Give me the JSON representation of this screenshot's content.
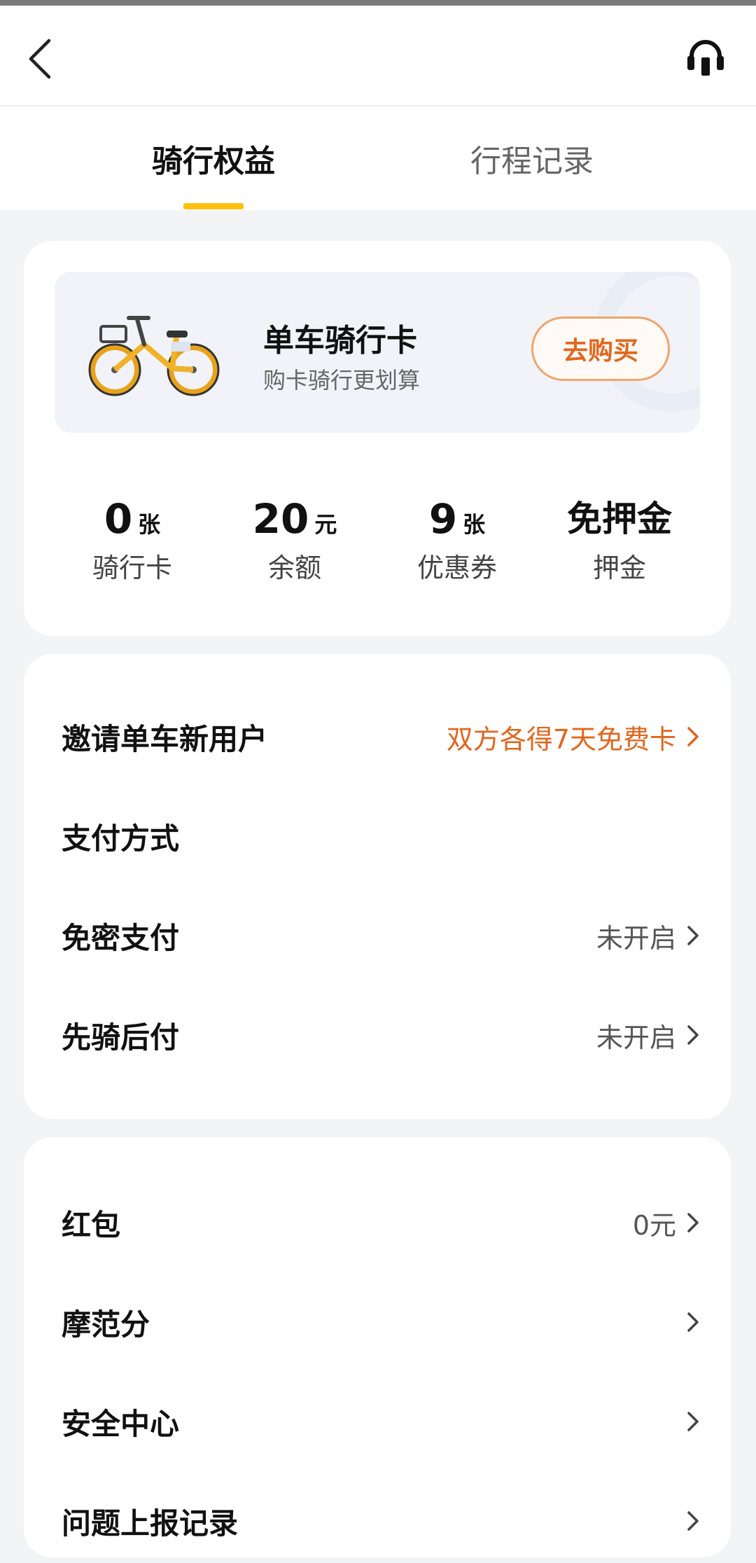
{
  "header": {
    "back_icon": "chevron-left-icon",
    "service_icon": "headset-icon"
  },
  "tabs": [
    {
      "label": "骑行权益",
      "active": true
    },
    {
      "label": "行程记录",
      "active": false
    }
  ],
  "promo": {
    "title": "单车骑行卡",
    "subtitle": "购卡骑行更划算",
    "buy_label": "去购买"
  },
  "stats": [
    {
      "value": "0",
      "unit": "张",
      "label": "骑行卡"
    },
    {
      "value": "20",
      "unit": "元",
      "label": "余额"
    },
    {
      "value": "9",
      "unit": "张",
      "label": "优惠券"
    },
    {
      "value": "免押金",
      "unit": "",
      "label": "押金"
    }
  ],
  "settings": [
    {
      "title": "邀请单车新用户",
      "value": "双方各得7天免费卡",
      "accent": true,
      "chevron": true
    },
    {
      "title": "支付方式",
      "value": "",
      "chevron": false
    },
    {
      "title": "免密支付",
      "value": "未开启",
      "chevron": true
    },
    {
      "title": "先骑后付",
      "value": "未开启",
      "chevron": true
    }
  ],
  "more": [
    {
      "title": "红包",
      "value": "0元",
      "chevron": true
    },
    {
      "title": "摩范分",
      "value": "",
      "chevron": true
    },
    {
      "title": "安全中心",
      "value": "",
      "chevron": true
    },
    {
      "title": "问题上报记录",
      "value": "",
      "chevron": true
    }
  ],
  "colors": {
    "accent_yellow": "#ffc10d",
    "accent_orange": "#e2661d",
    "page_bg": "#f3f4f6"
  }
}
